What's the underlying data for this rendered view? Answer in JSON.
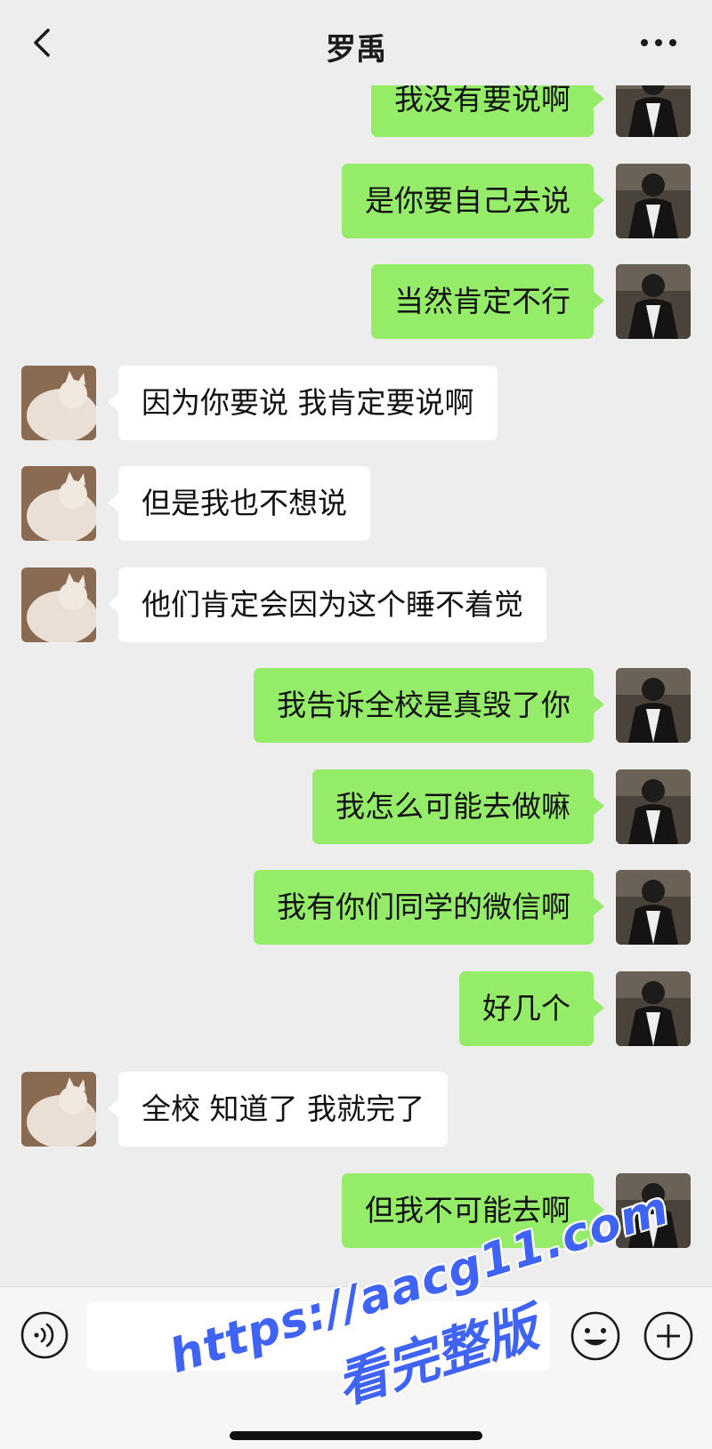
{
  "header": {
    "title": "罗禹",
    "back_icon": "chevron-left-icon",
    "more_icon": "more-dots-icon"
  },
  "messages": [
    {
      "sender": "me",
      "text": "我没有要说啊"
    },
    {
      "sender": "me",
      "text": "是你要自己去说"
    },
    {
      "sender": "me",
      "text": "当然肯定不行"
    },
    {
      "sender": "them",
      "text": "因为你要说 我肯定要说啊"
    },
    {
      "sender": "them",
      "text": "但是我也不想说"
    },
    {
      "sender": "them",
      "text": "他们肯定会因为这个睡不着觉"
    },
    {
      "sender": "me",
      "text": "我告诉全校是真毁了你"
    },
    {
      "sender": "me",
      "text": "我怎么可能去做嘛"
    },
    {
      "sender": "me",
      "text": "我有你们同学的微信啊"
    },
    {
      "sender": "me",
      "text": "好几个"
    },
    {
      "sender": "them",
      "text": "全校 知道了 我就完了"
    },
    {
      "sender": "me",
      "text": "但我不可能去啊"
    }
  ],
  "input_bar": {
    "voice_icon": "voice-icon",
    "text_value": "",
    "emoji_icon": "emoji-icon",
    "plus_icon": "plus-icon"
  },
  "watermark": {
    "url": "https://aacg11.com",
    "text": "看完整版"
  },
  "colors": {
    "background": "#ededed",
    "my_bubble": "#95ec69",
    "their_bubble": "#ffffff",
    "watermark": "#3f63f5"
  }
}
